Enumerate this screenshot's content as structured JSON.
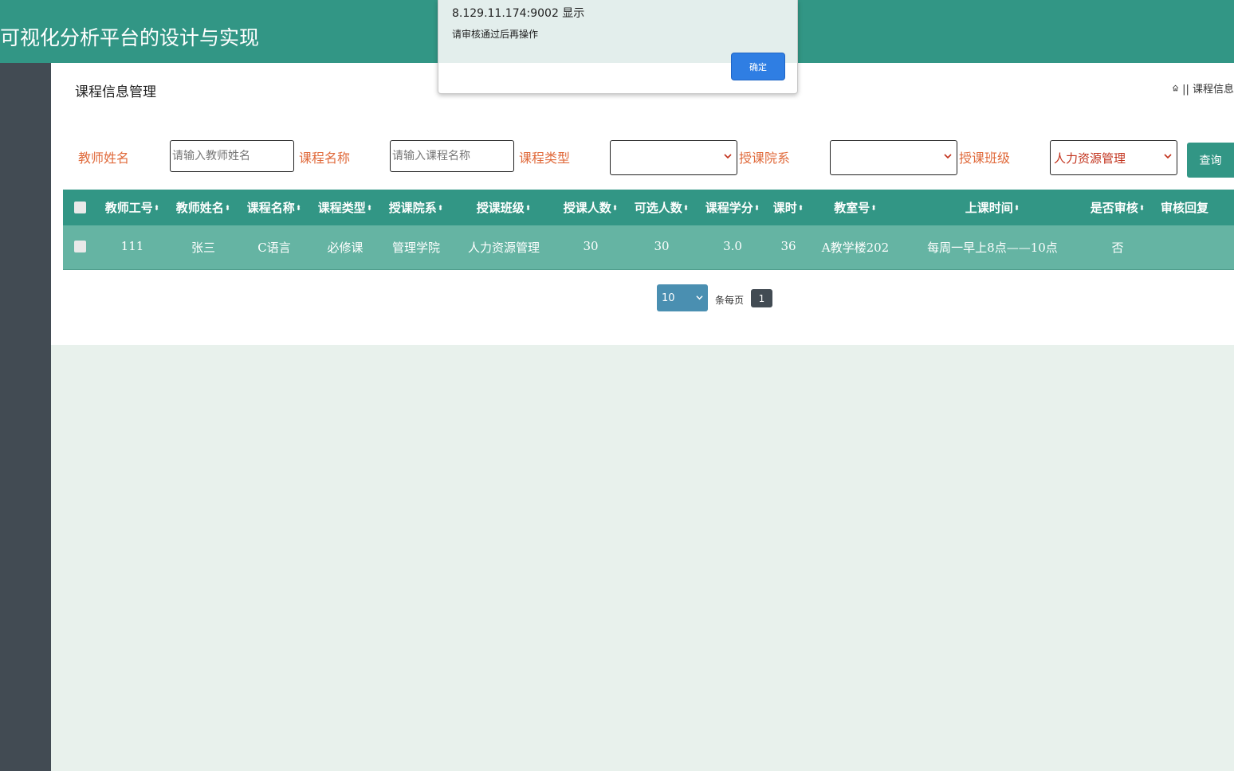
{
  "header": {
    "title": "可视化分析平台的设计与实现"
  },
  "page": {
    "title": "课程信息管理",
    "breadcrumb": "|| 课程信息"
  },
  "search": {
    "teacher_label": "教师姓名",
    "teacher_placeholder": "请输入教师姓名",
    "course_label": "课程名称",
    "course_placeholder": "请输入课程名称",
    "type_label": "课程类型",
    "type_value": "",
    "dept_label": "授课院系",
    "dept_value": "",
    "class_label": "授课班级",
    "class_value": "人力资源管理",
    "query_button": "查询"
  },
  "table": {
    "columns": [
      "教师工号",
      "教师姓名",
      "课程名称",
      "课程类型",
      "授课院系",
      "授课班级",
      "授课人数",
      "可选人数",
      "课程学分",
      "课时",
      "教室号",
      "上课时间",
      "是否审核",
      "审核回复"
    ],
    "rows": [
      [
        "111",
        "张三",
        "C语言",
        "必修课",
        "管理学院",
        "人力资源管理",
        "30",
        "30",
        "3.0",
        "36",
        "A教学楼202",
        "每周一早上8点——10点",
        "否",
        ""
      ]
    ]
  },
  "pagination": {
    "page_size": "10",
    "per_page_text": "条每页",
    "current_page": "1"
  },
  "dialog": {
    "origin": "8.129.11.174:9002 显示",
    "message": "请审核通过后再操作",
    "ok_button": "确定"
  },
  "colors": {
    "primary": "#329685",
    "sidebar": "#424b53",
    "row": "#65b4a3",
    "label": "#e06a3b",
    "dialog_button": "#2f7ee3"
  }
}
